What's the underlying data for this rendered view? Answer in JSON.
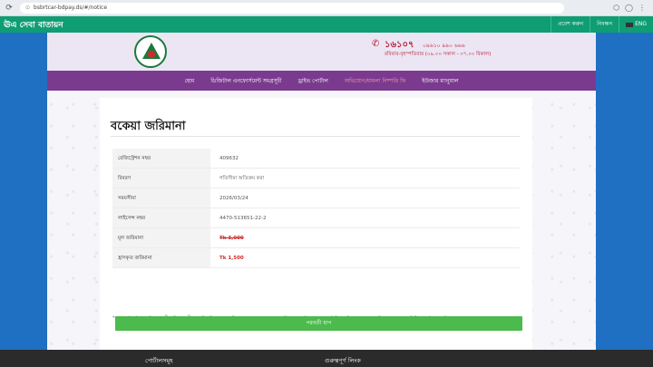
{
  "browser": {
    "url": "bsbrtcar-bdpay.ds/#/notice"
  },
  "site": {
    "brand": "ঊএ সেবা বাতায়ন",
    "top_links": [
      "প্রবেশ করুন",
      "নিবন্ধন"
    ],
    "language": "ENG"
  },
  "header": {
    "hotline_number": "১৬১০৭",
    "hotline_alt": "০৯৬১০ ৯৯০ ৬৬৬",
    "hotline_hours": "রবিবার-বৃহস্পতিবার (০৯.০০ সকাল - ০৭.০০ বিকাল)"
  },
  "menu": [
    "হোম",
    "ডিজিটাল এনফোর্সমেন্ট সমগ্রসূচী",
    "ড্রাইভ পোর্টাল",
    "অভিযোগ/মামলা নিষ্পত্তি ফি",
    "ইউজার ম্যানুয়াল"
  ],
  "menu_active_index": 3,
  "page": {
    "title": "বকেয়া জরিমানা",
    "rows": [
      {
        "label": "রেজিস্ট্রেশন নম্বর",
        "value": "409632"
      },
      {
        "label": "বিবরণ",
        "value": "গতিসীমা অতিক্রম করা"
      },
      {
        "label": "সময়সীমা",
        "value": "2026/03/24"
      },
      {
        "label": "লাইসেন্স নম্বর",
        "value": "4470-513651-22-2"
      },
      {
        "label": "মূল জরিমানা",
        "value": "Tk 3,000"
      },
      {
        "label": "হ্রাসকৃত জরিমানা",
        "value": "Tk 1,500"
      }
    ],
    "note": "*গুরুত্বপূর্ণ: বর্তমান আইন অনুযায়ী, যদি অপরাধী প্রথম তিন দিনের মধ্যে পরিশোধ করে, তাহলে জুনায়ারা পরিমাণের ৫০% কমানো হবে। ট্রাফিক জরিমানা সময়মতো পরিশোধ না করলে অতিরিক্ত চার্জ এবং আইনগত ব্যবস্থা গ্রহণ করা হতে পারে।",
    "next_button": "পরবর্তী ধাপ"
  },
  "footer": {
    "col1": "পোর্টালসমূহ",
    "col2": "গুরুত্বপূর্ণ লিংক"
  },
  "colors": {
    "topbar": "#0f9d73",
    "menubar": "#7a3b8f",
    "side_panels": "#1f6fc2",
    "button": "#4cba4c",
    "fine_red": "#cf2b2b"
  }
}
